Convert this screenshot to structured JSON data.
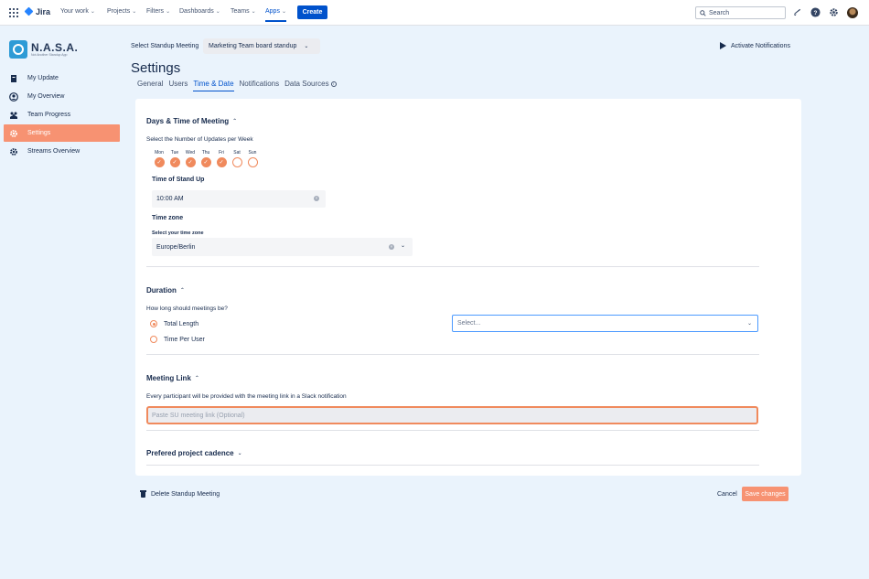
{
  "topbar": {
    "app_name": "Jira",
    "nav": [
      {
        "label": "Your work"
      },
      {
        "label": "Projects"
      },
      {
        "label": "Filters"
      },
      {
        "label": "Dashboards"
      },
      {
        "label": "Teams"
      },
      {
        "label": "Apps"
      }
    ],
    "create_label": "Create",
    "search_placeholder": "Search"
  },
  "brand": {
    "name": "N.A.S.A.",
    "tagline": "Not Another Standup App"
  },
  "sidebar": {
    "items": [
      {
        "label": "My Update",
        "icon": "document-icon"
      },
      {
        "label": "My Overview",
        "icon": "user-circle-icon"
      },
      {
        "label": "Team Progress",
        "icon": "people-icon"
      },
      {
        "label": "Settings",
        "icon": "gear-icon",
        "active": true
      },
      {
        "label": "Streams Overview",
        "icon": "gear-icon"
      }
    ]
  },
  "header": {
    "select_label": "Select Standup Meeting",
    "selected_meeting": "Marketing Team board standup",
    "activate_label": "Activate Notifications",
    "title": "Settings",
    "tabs": [
      {
        "label": "General"
      },
      {
        "label": "Users"
      },
      {
        "label": "Time & Date",
        "active": true
      },
      {
        "label": "Notifications"
      },
      {
        "label": "Data Sources"
      }
    ]
  },
  "days_section": {
    "title": "Days & Time of Meeting",
    "updates_label": "Select the Number of Updates per Week",
    "days": [
      {
        "label": "Mon",
        "checked": true
      },
      {
        "label": "Tue",
        "checked": true
      },
      {
        "label": "Wed",
        "checked": true
      },
      {
        "label": "Thu",
        "checked": true
      },
      {
        "label": "Fri",
        "checked": true
      },
      {
        "label": "Sat",
        "checked": false
      },
      {
        "label": "Sun",
        "checked": false
      }
    ],
    "time_label": "Time of Stand Up",
    "time_value": "10:00 AM",
    "timezone_label": "Time zone",
    "timezone_sublabel": "Select your time zone",
    "timezone_value": "Europe/Berlin"
  },
  "duration_section": {
    "title": "Duration",
    "question": "How long should meetings be?",
    "options": [
      {
        "label": "Total Length",
        "selected": true
      },
      {
        "label": "Time Per User",
        "selected": false
      }
    ],
    "select_placeholder": "Select..."
  },
  "meeting_link_section": {
    "title": "Meeting Link",
    "description": "Every participant will be provided with the meeting link in a Slack notification",
    "placeholder": "Paste SU meeting link (Optional)"
  },
  "cadence_section": {
    "title": "Prefered project cadence"
  },
  "footer": {
    "delete_label": "Delete Standup Meeting",
    "cancel_label": "Cancel",
    "save_label": "Save changes"
  },
  "colors": {
    "accent": "#F08A5D",
    "primary": "#0052CC",
    "background": "#EAF3FC"
  }
}
